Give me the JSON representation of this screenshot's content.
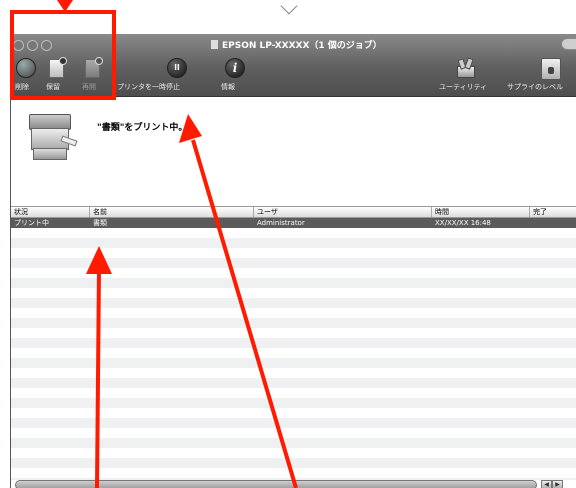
{
  "window": {
    "title": "EPSON LP-XXXXX（1 個のジョブ）"
  },
  "toolbar": {
    "delete_label": "削除",
    "hold_label": "保留",
    "resume_label": "再開",
    "pause_printer_label": "プリンタを一時停止",
    "info_label": "情報",
    "utility_label": "ユーティリティ",
    "supply_label": "サプライのレベル",
    "info_glyph": "i",
    "pause_glyph": "ll"
  },
  "status": {
    "message": "\"書類\"をプリント中。"
  },
  "table": {
    "headers": {
      "status": "状況",
      "name": "名前",
      "user": "ユーザ",
      "time": "時間",
      "completed": "完了"
    },
    "rows": [
      {
        "status": "プリント中",
        "name": "書類",
        "user": "Administrator",
        "time": "XX/XX/XX 16:48",
        "completed": ""
      }
    ]
  },
  "colors": {
    "annotation": "#ff1a00",
    "toolbar_top": "#8a8a8a",
    "toolbar_bottom": "#4e4e4e",
    "selected_row": "#5b5b5b"
  },
  "icons": [
    "delete-icon",
    "hold-icon",
    "resume-icon",
    "pause-icon",
    "info-icon",
    "utility-icon",
    "supply-icon",
    "printer-icon"
  ]
}
